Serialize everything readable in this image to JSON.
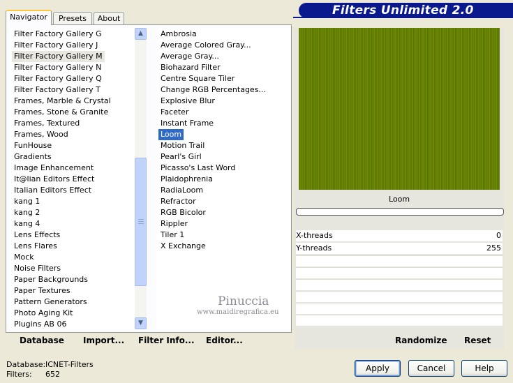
{
  "app_title": "Filters Unlimited 2.0",
  "tabs": [
    {
      "label": "Navigator",
      "active": true
    },
    {
      "label": "Presets",
      "active": false
    },
    {
      "label": "About",
      "active": false
    }
  ],
  "categories": {
    "items": [
      "Filter Factory Gallery G",
      "Filter Factory Gallery J",
      "Filter Factory Gallery M",
      "Filter Factory Gallery N",
      "Filter Factory Gallery Q",
      "Filter Factory Gallery T",
      "Frames, Marble & Crystal",
      "Frames, Stone & Granite",
      "Frames, Textured",
      "Frames, Wood",
      "FunHouse",
      "Gradients",
      "Image Enhancement",
      "It@lian Editors Effect",
      "Italian Editors Effect",
      "kang 1",
      "kang 2",
      "kang 4",
      "Lens Effects",
      "Lens Flares",
      "Mock",
      "Noise Filters",
      "Paper Backgrounds",
      "Paper Textures",
      "Pattern Generators",
      "Photo Aging Kit",
      "Plugins AB 06"
    ],
    "selected": "Filter Factory Gallery M"
  },
  "filters": {
    "items": [
      "Ambrosia",
      "Average Colored Gray...",
      "Average Gray...",
      "Biohazard Filter",
      "Centre Square Tiler",
      "Change RGB Percentages...",
      "Explosive Blur",
      "Faceter",
      "Instant Frame",
      "Loom",
      "Motion Trail",
      "Pearl's Girl",
      "Picasso's Last Word",
      "Plaidophrenia",
      "RadiaLoom",
      "Refractor",
      "RGB Bicolor",
      "Rippler",
      "Tiler 1",
      "X Exchange"
    ],
    "selected": "Loom"
  },
  "bottom_links": {
    "database": "Database",
    "import": "Import...",
    "filter_info": "Filter Info...",
    "editor": "Editor..."
  },
  "preview": {
    "filter_name": "Loom",
    "color": "#6e8a00"
  },
  "params": [
    {
      "label": "X-threads",
      "value": "0"
    },
    {
      "label": "Y-threads",
      "value": "255"
    }
  ],
  "right_buttons": {
    "randomize": "Randomize",
    "reset": "Reset"
  },
  "status": {
    "database_label": "Database:",
    "database_value": "ICNET-Filters",
    "filters_label": "Filters:",
    "filters_value": "652"
  },
  "buttons": {
    "apply": "Apply",
    "cancel": "Cancel",
    "help": "Help"
  },
  "watermark": {
    "name": "Pinuccia",
    "url": "www.maidiregrafica.eu"
  },
  "colors": {
    "accent": "#316ac5",
    "banner": "#0a1a8c"
  }
}
